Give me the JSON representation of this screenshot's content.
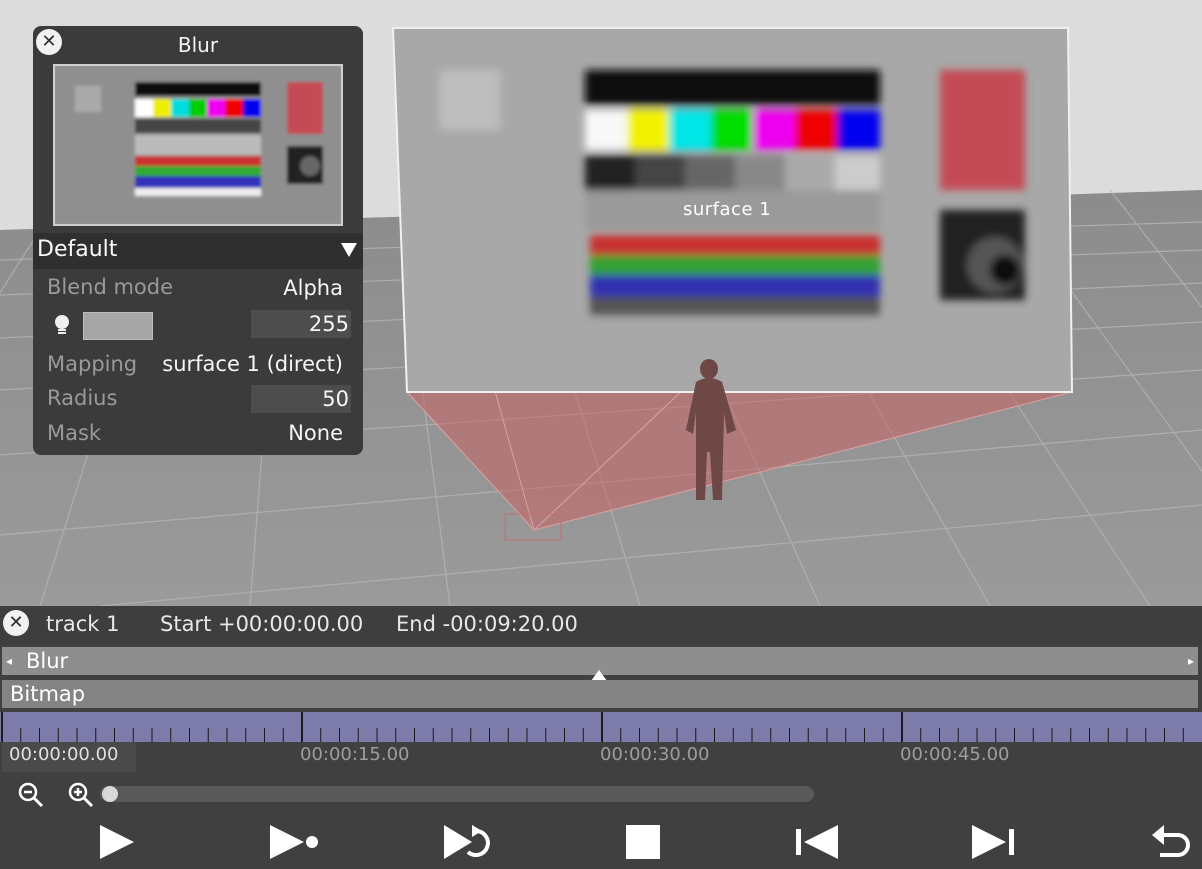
{
  "scene": {
    "surface_label": "surface 1"
  },
  "blur_panel": {
    "title": "Blur",
    "preset": "Default",
    "rows": {
      "blend_mode_label": "Blend mode",
      "blend_mode_value": "Alpha",
      "opacity_value": "255",
      "mapping_label": "Mapping",
      "mapping_value": "surface 1 (direct)",
      "radius_label": "Radius",
      "radius_value": "50",
      "mask_label": "Mask",
      "mask_value": "None"
    },
    "icons": {
      "close": "close-icon",
      "light": "lightbulb-icon",
      "dropdown": "triangle-down-icon"
    }
  },
  "timeline": {
    "track_name": "track 1",
    "start": "Start +00:00:00.00",
    "end": "End -00:09:20.00",
    "layers": [
      "Blur",
      "Bitmap"
    ],
    "ticks": [
      "00:00:00.00",
      "00:00:15.00",
      "00:00:30.00",
      "00:00:45.00"
    ],
    "zoom_level": 0.0,
    "colors": {
      "ruler": "#7c7ba9",
      "playhead": "#ffffff"
    },
    "controls": [
      "play-icon",
      "play-to-cue-icon",
      "loop-icon",
      "stop-icon",
      "previous-icon",
      "next-icon",
      "undo-icon"
    ]
  }
}
